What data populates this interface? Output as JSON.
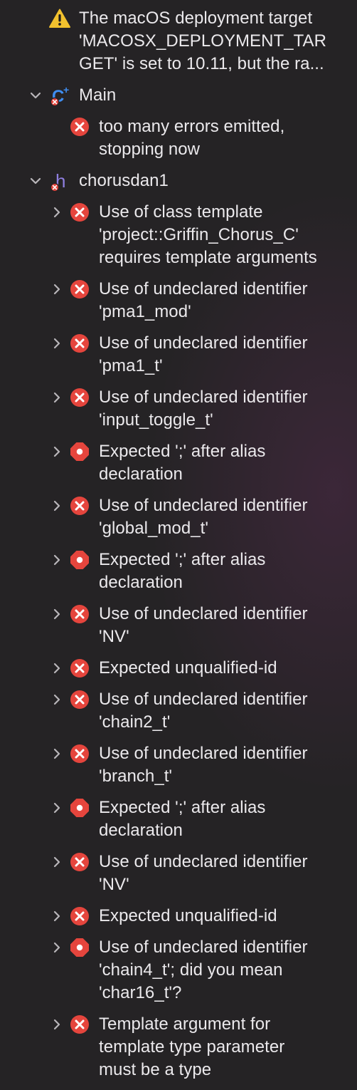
{
  "colors": {
    "error_red": "#e5453d",
    "warning_yellow": "#f2c12e",
    "swift_blue": "#3f8df0",
    "chevron_gray": "#b9b6ba",
    "text": "#ebe9ec",
    "background": "#252325"
  },
  "warning": {
    "icon": "warning-triangle-icon",
    "message": "The macOS deployment target\n'MACOSX_DEPLOYMENT_TAR\nGET' is set to 10.11, but the ra..."
  },
  "groups": [
    {
      "name": "Main",
      "file_icon": "cpp-file-icon",
      "file_letter": "C",
      "file_superscript": "+",
      "issues": [
        {
          "icon": "error-x-icon",
          "message": "too many errors emitted,\nstopping now"
        }
      ]
    },
    {
      "name": "chorusdan1",
      "file_icon": "header-file-icon",
      "file_letter": "h",
      "issues": [
        {
          "icon": "error-x-icon",
          "message": "Use of class template\n'project::Griffin_Chorus_C'\nrequires template arguments"
        },
        {
          "icon": "error-x-icon",
          "message": "Use of undeclared identifier\n'pma1_mod'"
        },
        {
          "icon": "error-x-icon",
          "message": "Use of undeclared identifier\n'pma1_t'"
        },
        {
          "icon": "error-x-icon",
          "message": "Use of undeclared identifier\n'input_toggle_t'"
        },
        {
          "icon": "error-dot-icon",
          "message": "Expected ';' after alias\ndeclaration"
        },
        {
          "icon": "error-x-icon",
          "message": "Use of undeclared identifier\n'global_mod_t'"
        },
        {
          "icon": "error-dot-icon",
          "message": "Expected ';' after alias\ndeclaration"
        },
        {
          "icon": "error-x-icon",
          "message": "Use of undeclared identifier\n'NV'"
        },
        {
          "icon": "error-x-icon",
          "message": "Expected unqualified-id"
        },
        {
          "icon": "error-x-icon",
          "message": "Use of undeclared identifier\n'chain2_t'"
        },
        {
          "icon": "error-x-icon",
          "message": "Use of undeclared identifier\n'branch_t'"
        },
        {
          "icon": "error-dot-icon",
          "message": "Expected ';' after alias\ndeclaration"
        },
        {
          "icon": "error-x-icon",
          "message": "Use of undeclared identifier\n'NV'"
        },
        {
          "icon": "error-x-icon",
          "message": "Expected unqualified-id"
        },
        {
          "icon": "error-dot-icon",
          "message": "Use of undeclared identifier\n'chain4_t'; did you mean\n'char16_t'?"
        },
        {
          "icon": "error-x-icon",
          "message": "Template argument for\ntemplate type parameter\nmust be a type"
        }
      ]
    }
  ]
}
